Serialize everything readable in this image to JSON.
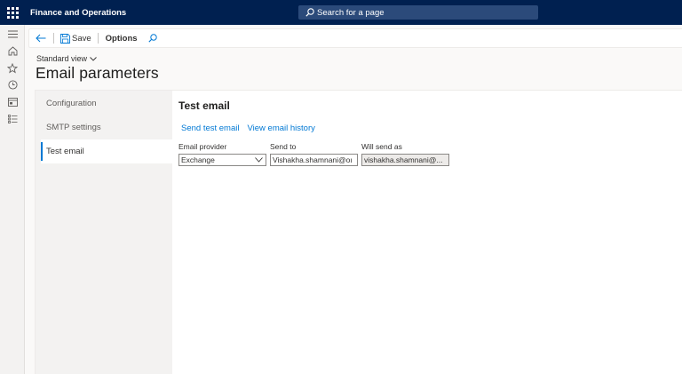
{
  "app": {
    "title": "Finance and Operations",
    "search_placeholder": "Search for a page"
  },
  "actionpane": {
    "save_label": "Save",
    "options_label": "Options"
  },
  "page": {
    "view_label": "Standard view",
    "title": "Email parameters"
  },
  "tabs": [
    {
      "label": "Configuration",
      "selected": false
    },
    {
      "label": "SMTP settings",
      "selected": false
    },
    {
      "label": "Test email",
      "selected": true
    }
  ],
  "test_email": {
    "title": "Test email",
    "links": {
      "send_test": "Send test email",
      "view_history": "View email history"
    },
    "fields": {
      "provider": {
        "label": "Email provider",
        "value": "Exchange"
      },
      "send_to": {
        "label": "Send to",
        "value": "Vishakha.shamnani@oı"
      },
      "will_send_as": {
        "label": "Will send as",
        "value": "vishakha.shamnani@..."
      }
    }
  },
  "rail_icons": [
    "hamburger-icon",
    "home-icon",
    "star-icon",
    "clock-icon",
    "workspace-icon",
    "list-icon"
  ],
  "colors": {
    "nav": "#002050",
    "accent": "#0078d4"
  }
}
